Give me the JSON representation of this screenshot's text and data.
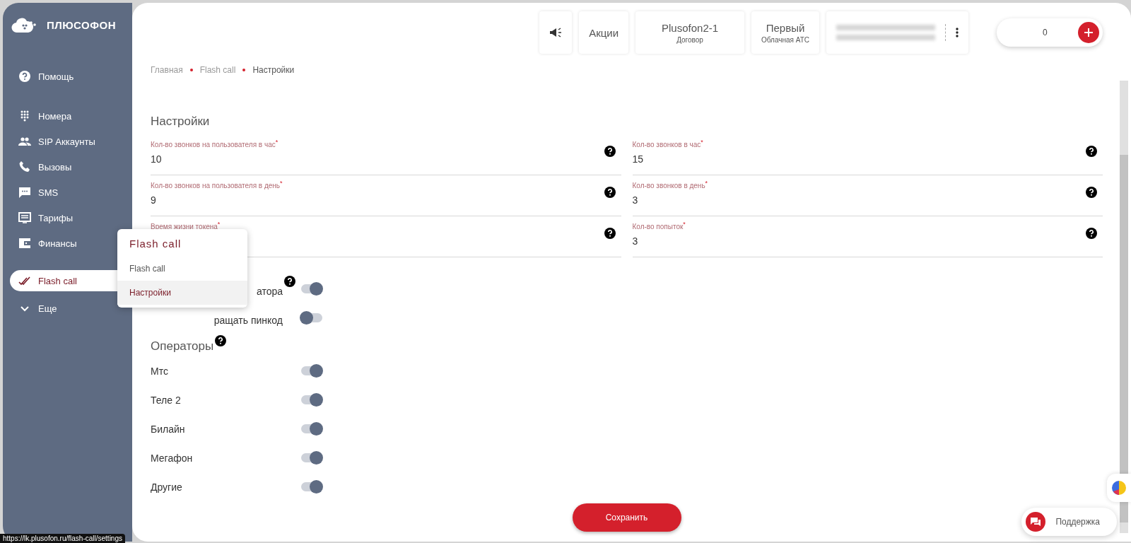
{
  "logo": {
    "text": "ПЛЮСОФОН"
  },
  "sidebar": {
    "groups": [
      [
        {
          "kind": "help",
          "label": "Помощь",
          "selected": false
        }
      ],
      [
        {
          "kind": "dialpad",
          "label": "Номера",
          "selected": false
        },
        {
          "kind": "people",
          "label": "SIP Аккаунты",
          "selected": false
        },
        {
          "kind": "phone",
          "label": "Вызовы",
          "selected": false
        },
        {
          "kind": "sms",
          "label": "SMS",
          "selected": false
        },
        {
          "kind": "tariff",
          "label": "Тарифы",
          "selected": false
        },
        {
          "kind": "wallet",
          "label": "Финансы",
          "selected": false
        }
      ],
      [
        {
          "kind": "flash",
          "label": "Flash call",
          "selected": true
        },
        {
          "kind": "more",
          "label": "Еще",
          "selected": false
        }
      ]
    ]
  },
  "topbar": {
    "items": [
      {
        "kind": "promo"
      },
      {
        "kind": "text",
        "title": "Акции"
      },
      {
        "kind": "stacked",
        "title": "Plusofon2-1",
        "subtitle": "Договор"
      },
      {
        "kind": "stacked",
        "title": "Первый",
        "subtitle": "Облачная АТС"
      },
      {
        "kind": "blurred"
      }
    ],
    "balance": {
      "value": "0"
    }
  },
  "breadcrumbs": [
    "Главная",
    "Flash call",
    "Настройки"
  ],
  "settings": {
    "title": "Настройки",
    "fields": [
      {
        "label": "Кол-во звонков на пользователя в час$^{*}$",
        "value": "10"
      },
      {
        "label": "Кол-во звонков в час$^{*}$",
        "value": "15"
      },
      {
        "label": "Кол-во звонков на пользователя в день$^{*}$",
        "value": "9"
      },
      {
        "label": "Кол-во звонков в день$^{*}$",
        "value": "3"
      },
      {
        "label": "Время жизни токена$^{*}$"
      },
      {
        "label": "Кол-во попыток$^{*}$",
        "value": "3"
      }
    ],
    "toggles": [
      {
        "label": "атора",
        "help": true,
        "on": true
      },
      {
        "label": "ращать пинкод",
        "help": false,
        "on": false
      }
    ]
  },
  "operators": {
    "title": "Операторы",
    "items": [
      {
        "label": "Мтс",
        "on": true
      },
      {
        "label": "Теле 2",
        "on": true
      },
      {
        "label": "Билайн",
        "on": true
      },
      {
        "label": "Мегафон",
        "on": true
      },
      {
        "label": "Другие",
        "on": true
      }
    ]
  },
  "menu": {
    "title": "Flash call",
    "items": [
      {
        "label": "Flash call",
        "selected": false
      },
      {
        "label": "Настройки",
        "selected": true
      }
    ]
  },
  "save_button": "Сохранить",
  "support": {
    "label": "Поддержка"
  },
  "status_url": "https://lk.plusofon.ru/flash-call/settings"
}
